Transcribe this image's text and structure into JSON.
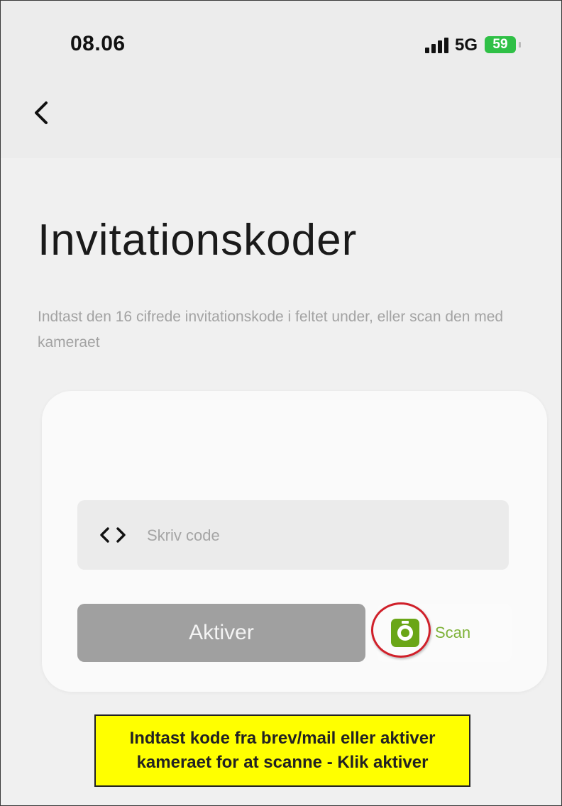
{
  "status_bar": {
    "time": "08.06",
    "network": "5G",
    "battery": "59"
  },
  "navigation": {
    "back_icon": "chevron-left-icon"
  },
  "page": {
    "title": "Invitationskoder",
    "instructions": "Indtast den 16 cifrede invitationskode i feltet under, eller scan den med kameraet"
  },
  "form": {
    "code_icon": "code-brackets-icon",
    "code_placeholder": "Skriv code",
    "code_value": "",
    "activate_label": "Aktiver",
    "scan_icon": "camera-icon",
    "scan_label": "Scan"
  },
  "annotation": {
    "text": "Indtast kode fra brev/mail eller aktiver\nkameraet for at scanne - Klik aktiver"
  },
  "colors": {
    "accent_green": "#6aa617",
    "button_gray": "#a0a0a0",
    "highlight_red": "#d0202a",
    "note_yellow": "#ffff00",
    "battery_green": "#2fc046"
  }
}
